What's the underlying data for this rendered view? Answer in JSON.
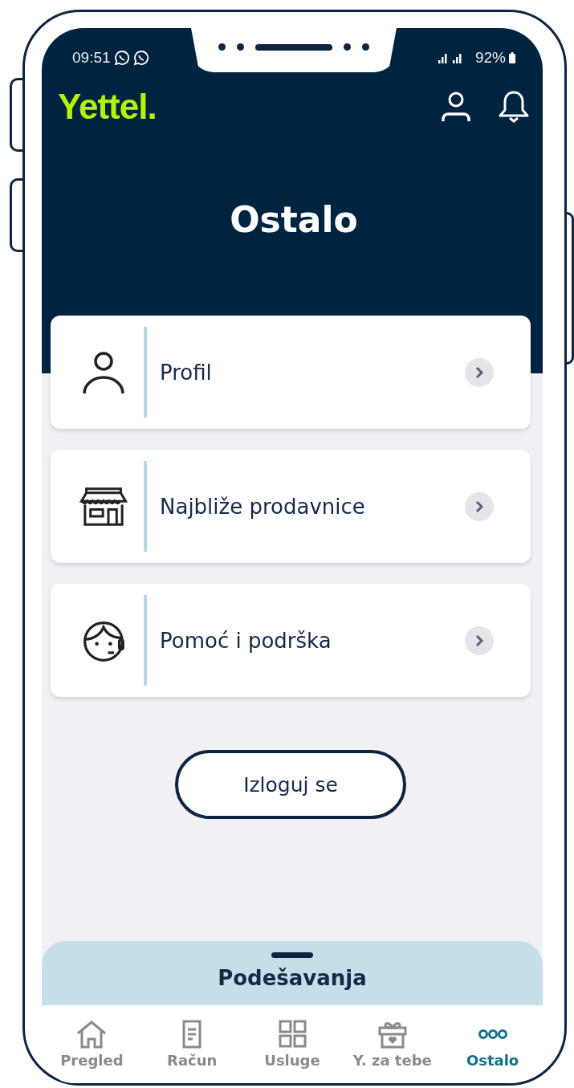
{
  "status_bar": {
    "time": "09:51",
    "battery": "92%"
  },
  "header": {
    "logo": "Yettel.",
    "title": "Ostalo"
  },
  "menu": [
    {
      "kind": "profile",
      "label": "Profil"
    },
    {
      "kind": "store",
      "label": "Najbliže prodavnice"
    },
    {
      "kind": "support",
      "label": "Pomoć i podrška"
    }
  ],
  "logout_button": "Izloguj se",
  "settings_sheet": {
    "title": "Podešavanja"
  },
  "bottom_nav": [
    {
      "kind": "home",
      "label": "Pregled",
      "selected": false
    },
    {
      "kind": "bill",
      "label": "Račun",
      "selected": false
    },
    {
      "kind": "grid",
      "label": "Usluge",
      "selected": false
    },
    {
      "kind": "gift",
      "label": "Y. za tebe",
      "selected": false
    },
    {
      "kind": "more",
      "label": "Ostalo",
      "selected": true
    }
  ]
}
